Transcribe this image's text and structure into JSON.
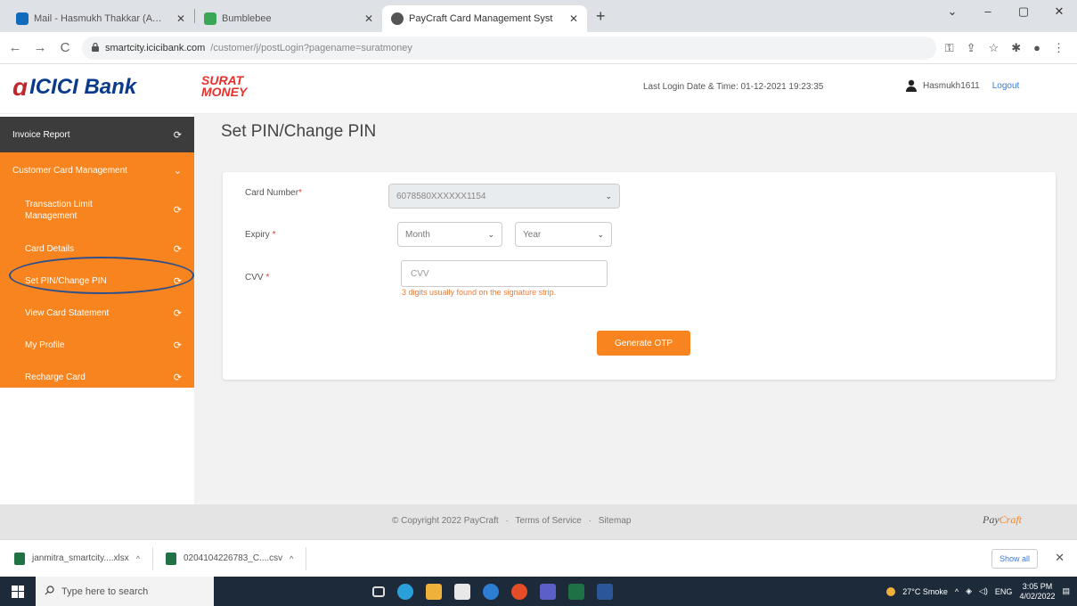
{
  "browser": {
    "tabs": [
      {
        "title": "Mail - Hasmukh Thakkar (AWSC)",
        "favicon_color": "#0f6cbd",
        "active": false
      },
      {
        "title": "Bumblebee",
        "favicon_color": "#3aa757",
        "active": false
      },
      {
        "title": "PayCraft Card Management Syst",
        "favicon_color": "#555555",
        "active": true
      }
    ],
    "new_tab": "+",
    "window_controls": {
      "chevron": "⌄",
      "minimize": "–",
      "maximize": "▢",
      "close": "✕"
    },
    "url_host": "smartcity.icicibank.com",
    "url_path": "/customer/j/postLogin?pagename=suratmoney",
    "nav": {
      "back": "←",
      "forward": "→",
      "reload": "C"
    }
  },
  "header": {
    "bank_name": "ICICI Bank",
    "brand_line1": "SURAT",
    "brand_line2": "MONEY",
    "last_login": "Last Login Date & Time: 01-12-2021 19:23:35",
    "username": "Hasmukh1611",
    "logout": "Logout"
  },
  "sidebar": {
    "items": [
      {
        "label": "Invoice Report",
        "style": "dark"
      },
      {
        "label": "Customer Card Management",
        "style": "cat"
      },
      {
        "label": "Transaction Limit Management",
        "style": "sub two"
      },
      {
        "label": "Card Details",
        "style": "sub"
      },
      {
        "label": "Set PIN/Change PIN",
        "style": "sub"
      },
      {
        "label": "View Card Statement",
        "style": "sub"
      },
      {
        "label": "My Profile",
        "style": "sub"
      },
      {
        "label": "Recharge Card",
        "style": "sub"
      }
    ]
  },
  "main": {
    "title": "Set PIN/Change PIN",
    "card_number_label": "Card Number",
    "card_number_value": "6078580XXXXXX1154",
    "expiry_label": "Expiry",
    "month_placeholder": "Month",
    "year_placeholder": "Year",
    "cvv_label": "CVV",
    "cvv_placeholder": "CVV",
    "cvv_hint": "3 digits usually found on the signature strip.",
    "generate_otp": "Generate OTP",
    "required_mark": "*"
  },
  "footer": {
    "copyright": "© Copyright 2022 PayCraft",
    "terms": "Terms of Service",
    "sitemap": "Sitemap",
    "sep": "·",
    "brand_pay": "Pay",
    "brand_craft": "Craft"
  },
  "downloads": {
    "items": [
      {
        "name": "janmitra_smartcity....xlsx"
      },
      {
        "name": "0204104226783_C....csv"
      }
    ],
    "show_all": "Show all",
    "close": "✕"
  },
  "taskbar": {
    "search_placeholder": "Type here to search",
    "apps": [
      "#3b7ad9",
      "#2aa0d8",
      "#f0b13a",
      "#e8e8e8",
      "#2d7dd2",
      "#e44d26",
      "#5b5fc7",
      "#1e7145",
      "#2b579a"
    ],
    "weather": "27°C Smoke",
    "lang": "ENG",
    "time": "3:05 PM",
    "date": "4/02/2022"
  }
}
